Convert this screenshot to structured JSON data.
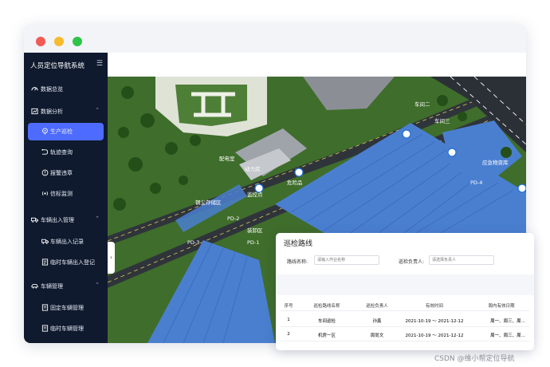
{
  "app": {
    "title": "人员定位导航系统",
    "menu_icon": "menu-icon"
  },
  "sidebar": {
    "items": [
      {
        "label": "数据总览",
        "icon": "dashboard-icon",
        "level": 1
      },
      {
        "label": "数据分析",
        "icon": "analysis-icon",
        "level": 1,
        "expanded": true
      },
      {
        "label": "生产巡检",
        "icon": "location-pin-icon",
        "level": 2,
        "active": true
      },
      {
        "label": "轨迹查询",
        "icon": "track-icon",
        "level": 2
      },
      {
        "label": "报警违章",
        "icon": "alarm-icon",
        "level": 2
      },
      {
        "label": "信标监测",
        "icon": "beacon-icon",
        "level": 2
      },
      {
        "label": "车辆出入管理",
        "icon": "truck-icon",
        "level": 1,
        "expanded": true
      },
      {
        "label": "车辆出入记录",
        "icon": "record-icon",
        "level": 2
      },
      {
        "label": "临时车辆出入登记",
        "icon": "register-icon",
        "level": 2
      },
      {
        "label": "车辆管理",
        "icon": "car-icon",
        "level": 1,
        "expanded": true
      },
      {
        "label": "固定车辆管理",
        "icon": "document-icon",
        "level": 2
      },
      {
        "label": "临时车辆管理",
        "icon": "document-icon",
        "level": 2
      }
    ]
  },
  "map": {
    "labels": [
      "车间二",
      "车间三",
      "动力房",
      "配电室",
      "钢尘存储区",
      "危险品",
      "PD-1",
      "PD-2",
      "PD-3",
      "PD-4",
      "监控点",
      "应急物资库",
      "装卸区"
    ]
  },
  "panel": {
    "title": "巡检路线",
    "route_name_label": "路线名称:",
    "route_name_placeholder": "请输入作业名称",
    "owner_label": "巡检负责人:",
    "owner_placeholder": "请选择负责人",
    "columns": [
      "序号",
      "巡检路线名称",
      "巡检负责人",
      "有效时间",
      "周内有效日期"
    ],
    "rows": [
      [
        "1",
        "车间巡检",
        "孙鑫",
        "2021-10-19 ～ 2021-12-12",
        "周一、周三、周..."
      ],
      [
        "2",
        "机房一区",
        "周尚文",
        "2021-10-19 ～ 2021-12-12",
        "周一、周三、周..."
      ]
    ]
  },
  "watermark": "CSDN @维小帮定位导航",
  "colors": {
    "sidebar_bg": "#0f1a2e",
    "accent": "#4e6bff",
    "roof_blue": "#4a7fd0",
    "grass": "#3d6b2a"
  }
}
